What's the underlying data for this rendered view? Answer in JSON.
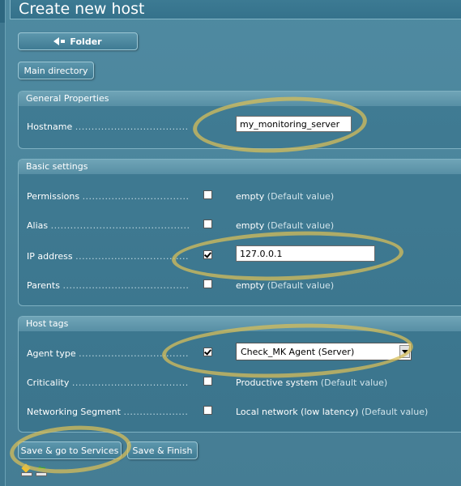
{
  "header": {
    "title": "Create new host"
  },
  "nav": {
    "folder_label": "Folder",
    "main_directory_label": "Main directory"
  },
  "general": {
    "title": "General Properties",
    "hostname": {
      "label": "Hostname",
      "value": "my_monitoring_server"
    }
  },
  "basic": {
    "title": "Basic settings",
    "permissions": {
      "label": "Permissions",
      "checked": false,
      "value": "empty",
      "default_note": "(Default value)"
    },
    "alias": {
      "label": "Alias",
      "checked": false,
      "value": "empty",
      "default_note": "(Default value)"
    },
    "ip_address": {
      "label": "IP address",
      "checked": true,
      "value": "127.0.0.1"
    },
    "parents": {
      "label": "Parents",
      "checked": false,
      "value": "empty",
      "default_note": "(Default value)"
    }
  },
  "tags": {
    "title": "Host tags",
    "agent_type": {
      "label": "Agent type",
      "checked": true,
      "selected": "Check_MK Agent (Server)"
    },
    "criticality": {
      "label": "Criticality",
      "checked": false,
      "value": "Productive system",
      "default_note": "(Default value)"
    },
    "networking": {
      "label": "Networking Segment",
      "checked": false,
      "value": "Local network (low latency)",
      "default_note": "(Default value)"
    }
  },
  "actions": {
    "save_services_label": "Save & go to Services",
    "save_finish_label": "Save & Finish"
  },
  "dots": "...........................................................................",
  "colors": {
    "background": "#4a849b",
    "highlight": "#d6be5a",
    "section_head": "#6fa4b7"
  }
}
